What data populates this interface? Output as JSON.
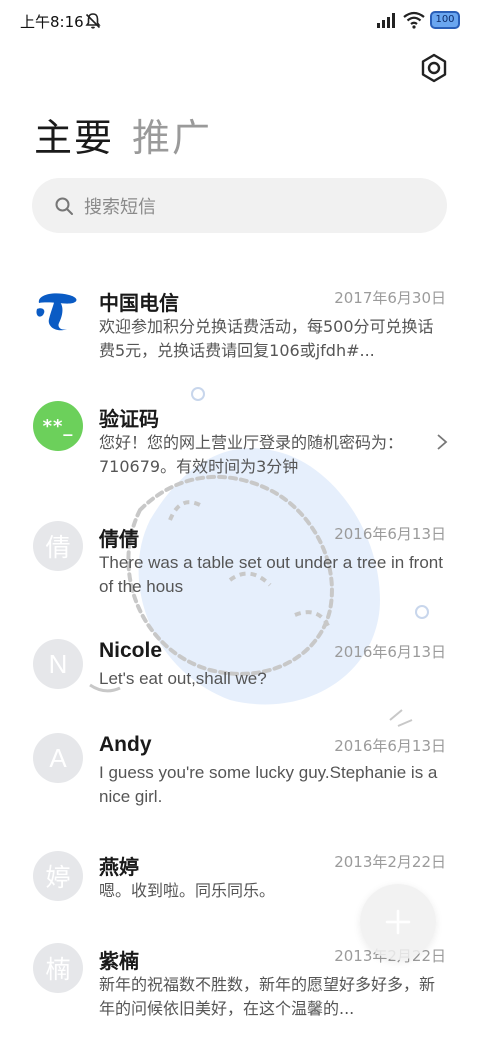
{
  "status_bar": {
    "time": "上午8:16",
    "battery": "100",
    "icons": [
      "mute-icon",
      "signal-icon",
      "wifi-icon",
      "battery-icon"
    ]
  },
  "header": {
    "settings_icon": "gear-icon"
  },
  "tabs": [
    {
      "label": "主要",
      "active": true
    },
    {
      "label": "推广",
      "active": false
    }
  ],
  "search": {
    "placeholder": "搜索短信",
    "icon": "search-icon"
  },
  "conversations": [
    {
      "avatar": "",
      "avatar_type": "china-telecom-logo",
      "name": "中国电信",
      "date": "2017年6月30日",
      "preview": "欢迎参加积分兑换话费活动，每500分可兑换话费5元，兑换话费请回复106或jfdh#..."
    },
    {
      "avatar": "**_",
      "avatar_type": "green",
      "name": "验证码",
      "date": "",
      "preview": "您好！您的网上营业厅登录的随机密码为：710679。有效时间为3分钟",
      "chevron": "chevron-right-icon"
    },
    {
      "avatar": "倩",
      "avatar_type": "initial",
      "name": "倩倩",
      "date": "2016年6月13日",
      "preview": "There was a table set out under a tree in front of the hous"
    },
    {
      "avatar": "N",
      "avatar_type": "initial",
      "name": "Nicole",
      "date": "2016年6月13日",
      "preview": "Let's eat out,shall we?"
    },
    {
      "avatar": "A",
      "avatar_type": "initial",
      "name": "Andy",
      "date": "2016年6月13日",
      "preview": "I guess you're some lucky guy.Stephanie is a nice girl."
    },
    {
      "avatar": "婷",
      "avatar_type": "initial",
      "name": "燕婷",
      "date": "2013年2月22日",
      "preview": "嗯。收到啦。同乐同乐。"
    },
    {
      "avatar": "楠",
      "avatar_type": "initial",
      "name": "紫楠",
      "date": "2013年2月22日",
      "preview": "新年的祝福数不胜数，新年的愿望好多好多，新年的问候依旧美好，在这个温馨的..."
    }
  ],
  "fab": {
    "icon": "plus-icon"
  },
  "colors": {
    "accent_green": "#6cd05b",
    "telecom_blue": "#0a5bc4",
    "avatar_gray": "#e6e7ea"
  }
}
